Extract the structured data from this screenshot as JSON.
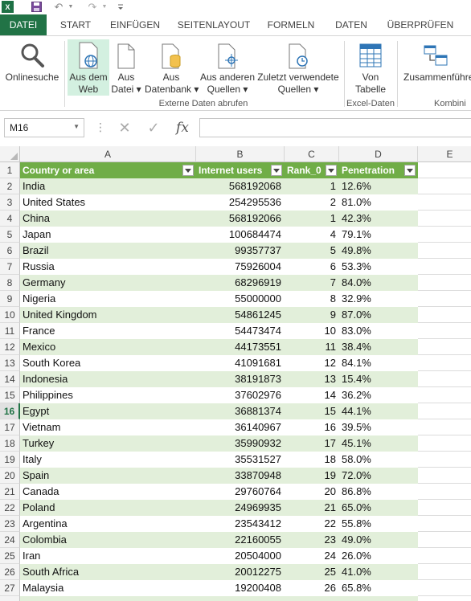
{
  "quick_access": {
    "app_icon": "excel-icon",
    "app_glyph": "X",
    "save_icon": "save-icon",
    "undo_icon": "undo-icon",
    "redo_icon": "redo-icon",
    "customize_icon": "customize-toolbar-icon"
  },
  "tabs": [
    {
      "label": "DATEI",
      "active": true
    },
    {
      "label": "START",
      "active": false
    },
    {
      "label": "EINFÜGEN",
      "active": false
    },
    {
      "label": "SEITENLAYOUT",
      "active": false
    },
    {
      "label": "FORMELN",
      "active": false
    },
    {
      "label": "DATEN",
      "active": false
    },
    {
      "label": "ÜBERPRÜFEN",
      "active": false
    }
  ],
  "ribbon": {
    "buttons": {
      "online_search": {
        "line1": "Onlinesuche",
        "line2": ""
      },
      "from_web": {
        "line1": "Aus dem",
        "line2": "Web"
      },
      "from_file": {
        "line1": "Aus",
        "line2": "Datei ▾"
      },
      "from_database": {
        "line1": "Aus",
        "line2": "Datenbank ▾"
      },
      "from_other": {
        "line1": "Aus anderen",
        "line2": "Quellen ▾"
      },
      "recent_sources": {
        "line1": "Zuletzt verwendete",
        "line2": "Quellen ▾"
      },
      "from_table": {
        "line1": "Von",
        "line2": "Tabelle"
      },
      "merge": {
        "line1": "Zusammenführe",
        "line2": ""
      }
    },
    "groups": {
      "external": "Externe Daten abrufen",
      "excel": "Excel-Daten",
      "combine": "Kombini"
    }
  },
  "formula_bar": {
    "name_box": "M16",
    "dots": "⋮",
    "cancel_glyph": "✕",
    "enter_glyph": "✓",
    "fx_label": "fx",
    "formula": ""
  },
  "grid": {
    "columns": [
      "A",
      "B",
      "C",
      "D",
      "E"
    ],
    "selected_row": 16,
    "headers": [
      "Country or area",
      "Internet users",
      "Rank_0",
      "Penetration"
    ],
    "rows": [
      {
        "n": "2",
        "country": "India",
        "users": "568192068",
        "rank": "1",
        "pen": "12.6%"
      },
      {
        "n": "3",
        "country": "United States",
        "users": "254295536",
        "rank": "2",
        "pen": "81.0%"
      },
      {
        "n": "4",
        "country": "China",
        "users": "568192066",
        "rank": "1",
        "pen": "42.3%"
      },
      {
        "n": "5",
        "country": "Japan",
        "users": "100684474",
        "rank": "4",
        "pen": "79.1%"
      },
      {
        "n": "6",
        "country": "Brazil",
        "users": "99357737",
        "rank": "5",
        "pen": "49.8%"
      },
      {
        "n": "7",
        "country": "Russia",
        "users": "75926004",
        "rank": "6",
        "pen": "53.3%"
      },
      {
        "n": "8",
        "country": "Germany",
        "users": "68296919",
        "rank": "7",
        "pen": "84.0%"
      },
      {
        "n": "9",
        "country": "Nigeria",
        "users": "55000000",
        "rank": "8",
        "pen": "32.9%"
      },
      {
        "n": "10",
        "country": "United Kingdom",
        "users": "54861245",
        "rank": "9",
        "pen": "87.0%"
      },
      {
        "n": "11",
        "country": "France",
        "users": "54473474",
        "rank": "10",
        "pen": "83.0%"
      },
      {
        "n": "12",
        "country": "Mexico",
        "users": "44173551",
        "rank": "11",
        "pen": "38.4%"
      },
      {
        "n": "13",
        "country": "South Korea",
        "users": "41091681",
        "rank": "12",
        "pen": "84.1%"
      },
      {
        "n": "14",
        "country": "Indonesia",
        "users": "38191873",
        "rank": "13",
        "pen": "15.4%"
      },
      {
        "n": "15",
        "country": "Philippines",
        "users": "37602976",
        "rank": "14",
        "pen": "36.2%"
      },
      {
        "n": "16",
        "country": "Egypt",
        "users": "36881374",
        "rank": "15",
        "pen": "44.1%"
      },
      {
        "n": "17",
        "country": "Vietnam",
        "users": "36140967",
        "rank": "16",
        "pen": "39.5%"
      },
      {
        "n": "18",
        "country": "Turkey",
        "users": "35990932",
        "rank": "17",
        "pen": "45.1%"
      },
      {
        "n": "19",
        "country": "Italy",
        "users": "35531527",
        "rank": "18",
        "pen": "58.0%"
      },
      {
        "n": "20",
        "country": "Spain",
        "users": "33870948",
        "rank": "19",
        "pen": "72.0%"
      },
      {
        "n": "21",
        "country": "Canada",
        "users": "29760764",
        "rank": "20",
        "pen": "86.8%"
      },
      {
        "n": "22",
        "country": "Poland",
        "users": "24969935",
        "rank": "21",
        "pen": "65.0%"
      },
      {
        "n": "23",
        "country": "Argentina",
        "users": "23543412",
        "rank": "22",
        "pen": "55.8%"
      },
      {
        "n": "24",
        "country": "Colombia",
        "users": "22160055",
        "rank": "23",
        "pen": "49.0%"
      },
      {
        "n": "25",
        "country": "Iran",
        "users": "20504000",
        "rank": "24",
        "pen": "26.0%"
      },
      {
        "n": "26",
        "country": "South Africa",
        "users": "20012275",
        "rank": "25",
        "pen": "41.0%"
      },
      {
        "n": "27",
        "country": "Malaysia",
        "users": "19200408",
        "rank": "26",
        "pen": "65.8%"
      }
    ]
  },
  "colors": {
    "accent": "#217346",
    "table_header": "#70ad47",
    "band": "#e2efda"
  }
}
